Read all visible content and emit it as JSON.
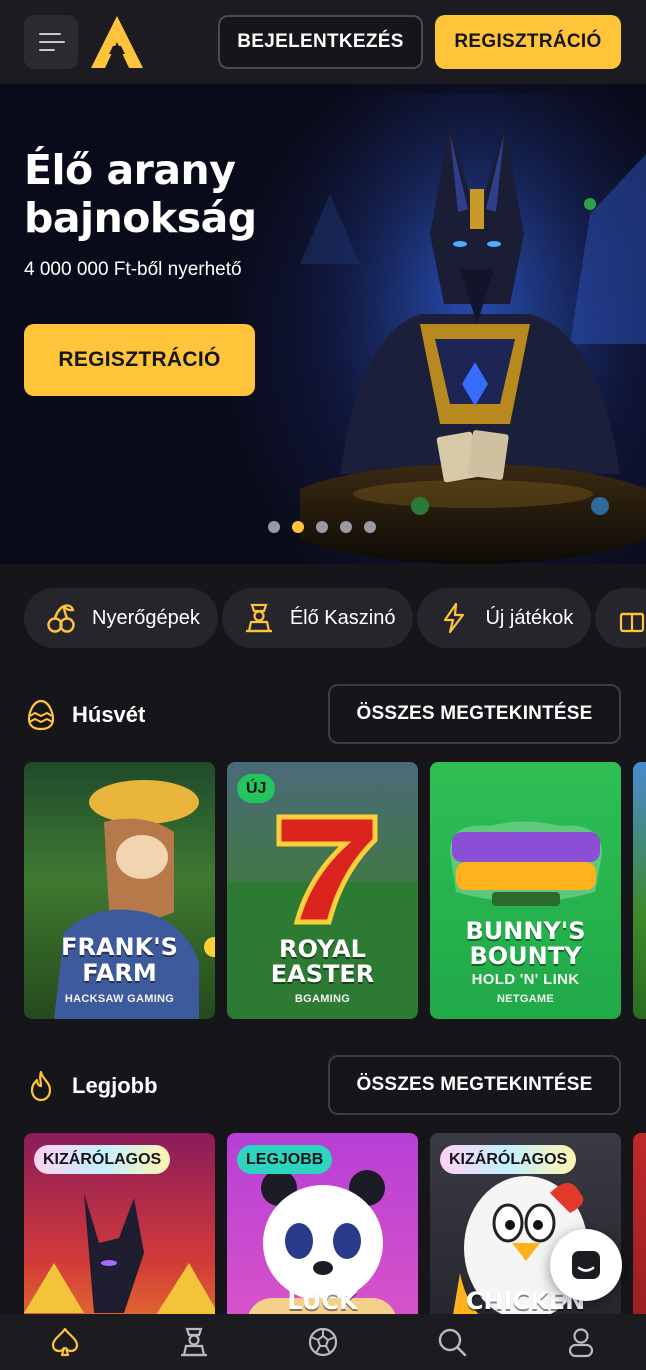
{
  "header": {
    "login_label": "BEJELENTKEZÉS",
    "register_label": "REGISZTRÁCIÓ"
  },
  "hero": {
    "title": "Élő arany bajnokság",
    "subtitle": "4 000 000 Ft-ből nyerhető",
    "cta_label": "REGISZTRÁCIÓ",
    "slide_count": 5,
    "active_slide": 2
  },
  "categories": [
    {
      "label": "Nyerőgépek",
      "icon": "cherries-icon"
    },
    {
      "label": "Élő Kaszinó",
      "icon": "dealer-icon"
    },
    {
      "label": "Új játékok",
      "icon": "lightning-icon"
    },
    {
      "label": "",
      "icon": "gift-icon"
    }
  ],
  "sections": {
    "easter": {
      "title": "Húsvét",
      "see_all_label": "ÖSSZES MEGTEKINTÉSE",
      "games": [
        {
          "name_line1": "FRANK'S",
          "name_line2": "FARM",
          "provider": "HACKSAW GAMING",
          "badge": ""
        },
        {
          "name_line1": "ROYAL",
          "name_line2": "EASTER",
          "provider": "BGAMING",
          "badge": "ÚJ"
        },
        {
          "name_line1": "BUNNY'S",
          "name_line2": "BOUNTY",
          "name_line3": "HOLD 'N' LINK",
          "provider": "NETGAME",
          "badge": ""
        }
      ]
    },
    "best": {
      "title": "Legjobb",
      "see_all_label": "ÖSSZES MEGTEKINTÉSE",
      "games": [
        {
          "badge": "KIZÁRÓLAGOS",
          "name_line1": ""
        },
        {
          "badge": "LEGJOBB",
          "name_line1": "LUCK"
        },
        {
          "badge": "KIZÁRÓLAGOS",
          "name_line1": "CHICKEN"
        }
      ]
    }
  },
  "bottom_nav": [
    {
      "icon": "spade-icon",
      "active": true
    },
    {
      "icon": "dealer-icon",
      "active": false
    },
    {
      "icon": "soccer-ball-icon",
      "active": false
    },
    {
      "icon": "search-icon",
      "active": false
    },
    {
      "icon": "user-icon",
      "active": false
    }
  ],
  "colors": {
    "accent": "#ffc43a",
    "background": "#15151a",
    "surface": "#25252b"
  }
}
